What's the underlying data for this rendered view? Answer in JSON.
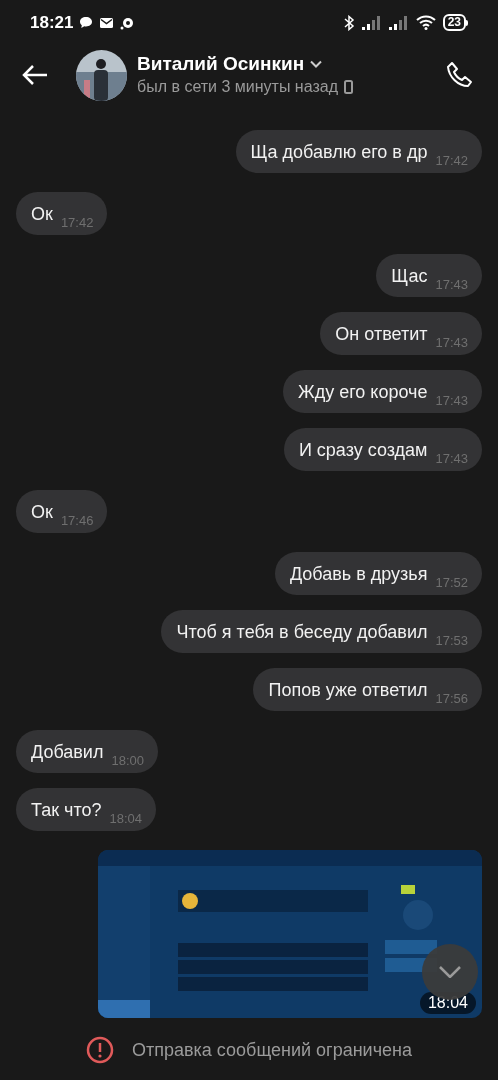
{
  "status_bar": {
    "time": "18:21",
    "battery": "23"
  },
  "header": {
    "name": "Виталий Осинкин",
    "status": "был в сети 3 минуты назад"
  },
  "messages": [
    {
      "kind": "text",
      "outgoing": true,
      "text": "Ща добавлю его в др",
      "time": "17:42"
    },
    {
      "kind": "text",
      "outgoing": false,
      "text": "Ок",
      "time": "17:42"
    },
    {
      "kind": "text",
      "outgoing": true,
      "text": "Щас",
      "time": "17:43"
    },
    {
      "kind": "text",
      "outgoing": true,
      "text": "Он ответит",
      "time": "17:43"
    },
    {
      "kind": "text",
      "outgoing": true,
      "text": "Жду его короче",
      "time": "17:43"
    },
    {
      "kind": "text",
      "outgoing": true,
      "text": "И сразу создам",
      "time": "17:43"
    },
    {
      "kind": "text",
      "outgoing": false,
      "text": "Ок",
      "time": "17:46"
    },
    {
      "kind": "text",
      "outgoing": true,
      "text": "Добавь в друзья",
      "time": "17:52"
    },
    {
      "kind": "text",
      "outgoing": true,
      "text": "Чтоб я тебя в беседу добавил",
      "time": "17:53"
    },
    {
      "kind": "text",
      "outgoing": true,
      "text": "Попов уже ответил",
      "time": "17:56"
    },
    {
      "kind": "text",
      "outgoing": false,
      "text": "Добавил",
      "time": "18:00"
    },
    {
      "kind": "text",
      "outgoing": false,
      "text": "Так что?",
      "time": "18:04"
    },
    {
      "kind": "picture",
      "outgoing": true,
      "time": "18:04"
    }
  ],
  "notice": "Отправка сообщений ограничена"
}
